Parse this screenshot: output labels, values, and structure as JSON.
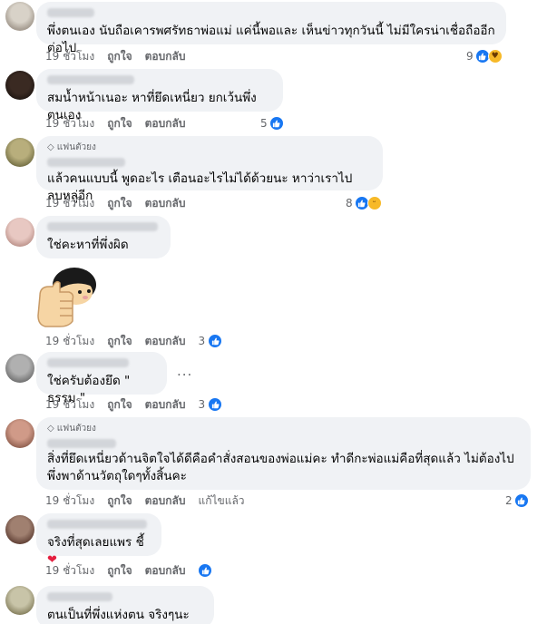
{
  "labels": {
    "time": "19 ชั่วโมง",
    "like": "ถูกใจ",
    "reply": "ตอบกลับ",
    "edited": "แก้ไขแล้ว"
  },
  "comments": [
    {
      "text": "พึ่งตนเอง นับถือเคารพศรัทธาพ่อแม่ แค่นี้พอและ เห็นข่าวทุกวันนี้ ไม่มีใครน่าเชื่อถืออีกต่อไป",
      "reactions": "9"
    },
    {
      "text": "สมน้ำหน้าเนอะ หาที่ยึดเหนี่ยว ยกเว้นพึ่งตนเอง",
      "reactions": "5"
    },
    {
      "badge": "แฟนตัวยง",
      "text": "แล้วคนแบบนี้ พูดอะไร เตือนอะไรไม่ได้ด้วยนะ หาว่าเราไปลบหลู่อีก",
      "reactions": "8"
    },
    {
      "text": "ใช่คะหาที่พึ่งผิด",
      "reactions": "3",
      "sticker": "thumbs-up-girl-sticker"
    },
    {
      "text": "ใช่ครับต้องยึด \" ธรรม \"",
      "reactions": "3",
      "more": "..."
    },
    {
      "badge": "แฟนตัวยง",
      "text": "สิ่งที่ยึดเหนี่ยวด้านจิตใจได้ดีคือคำสั่งสอนของพ่อแม่คะ ทำดีกะพ่อแม่คือที่สุดแล้ว ไม่ต้องไปพึ่งพาด้านวัตถุใดๆทั้งสิ้นคะ",
      "reactions": "2",
      "edited": true
    },
    {
      "text": "จริงที่สุดเลยแพร ชี้",
      "reactions": ""
    },
    {
      "text": "ตนเป็นที่พึ่งแห่งตน จริงๆนะคะ...."
    }
  ],
  "colors": {
    "like": "#1877f2",
    "bubble": "#f0f2f5",
    "meta": "#65676b",
    "heart": "#e41e3f"
  },
  "icons": {
    "like": "like-icon",
    "laugh": "haha-icon",
    "care": "care-icon",
    "love": "heart-icon",
    "fan": "diamond-icon",
    "more": "more-icon"
  }
}
